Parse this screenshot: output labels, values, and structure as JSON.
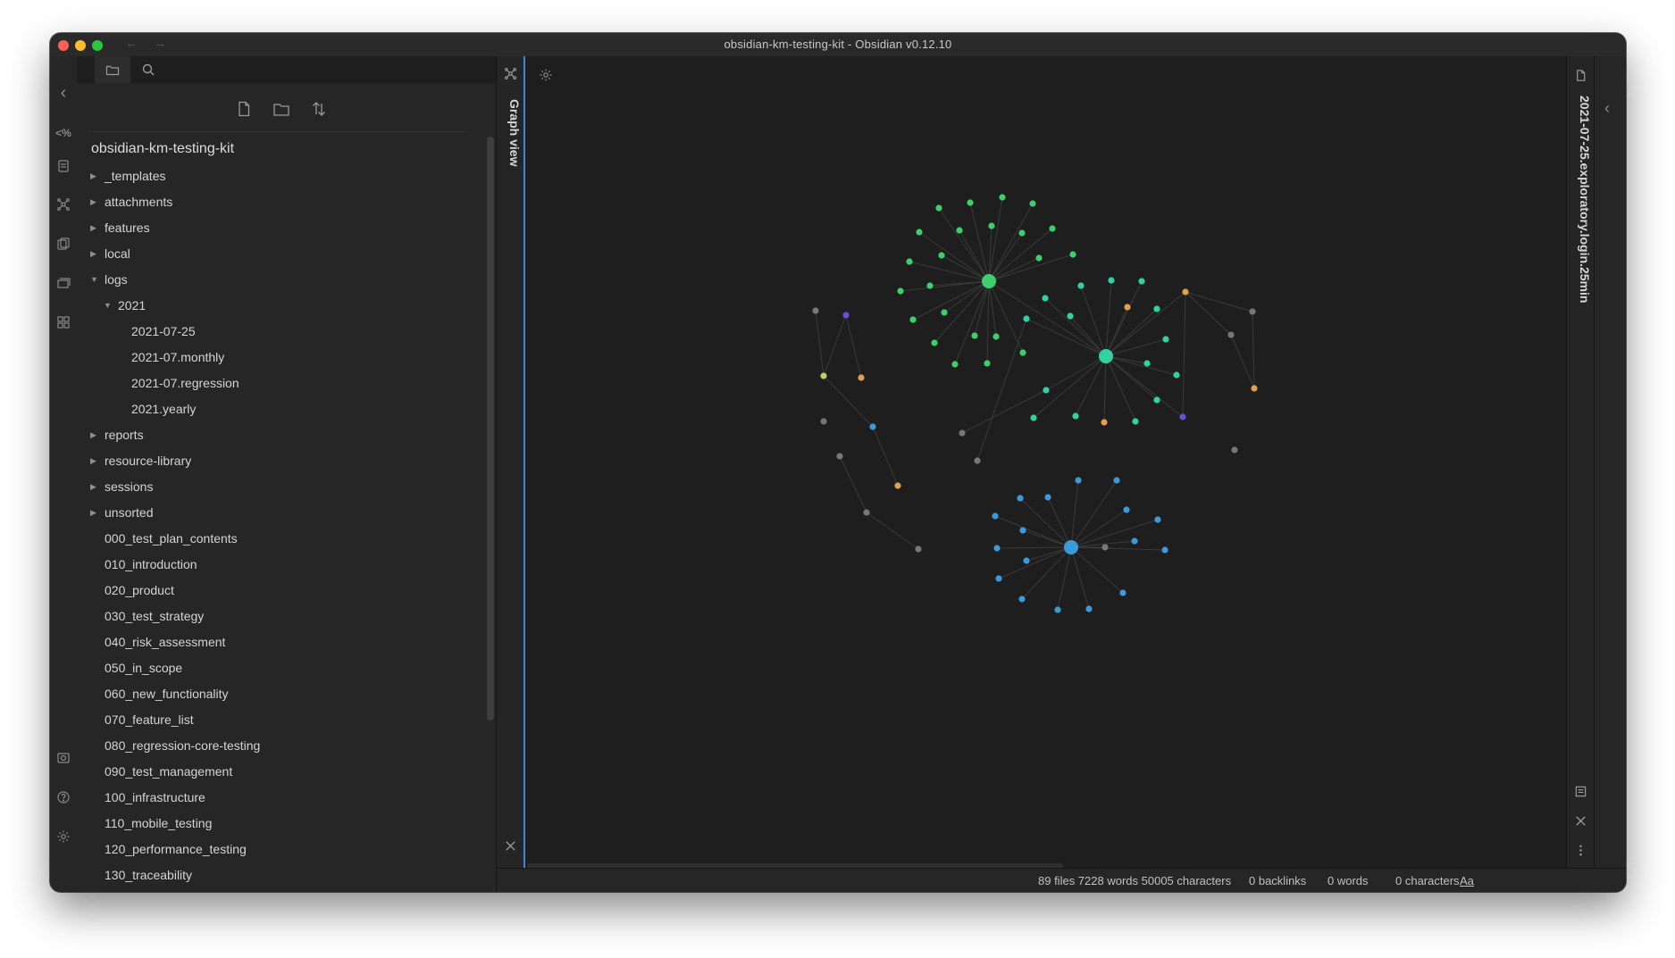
{
  "window": {
    "title": "obsidian-km-testing-kit - Obsidian v0.12.10"
  },
  "titlebar": {
    "back_arrow": "←",
    "forward_arrow": "→"
  },
  "ribbon": {
    "items": [
      {
        "name": "collapse-left-icon",
        "glyph": "‹"
      },
      {
        "name": "templater-icon",
        "glyph": "<%"
      },
      {
        "name": "daily-notes-icon",
        "glyph": "▤"
      },
      {
        "name": "graph-icon",
        "glyph": "⁂"
      },
      {
        "name": "slides-icon",
        "glyph": "❐"
      },
      {
        "name": "kanban-icon",
        "glyph": "▦"
      },
      {
        "name": "plugins-icon",
        "glyph": "▥"
      },
      {
        "name": "vault-icon",
        "glyph": "▣"
      },
      {
        "name": "help-icon",
        "glyph": "?"
      },
      {
        "name": "settings-icon",
        "glyph": "⚙"
      }
    ]
  },
  "sidebar": {
    "tabs": [
      {
        "name": "file-explorer-tab"
      },
      {
        "name": "search-tab"
      }
    ],
    "actions": [
      "new-note",
      "new-folder",
      "change-sort-order"
    ],
    "vault_name": "obsidian-km-testing-kit",
    "tree": [
      {
        "label": "_templates",
        "type": "folder",
        "level": 1,
        "expanded": false
      },
      {
        "label": "attachments",
        "type": "folder",
        "level": 1,
        "expanded": false
      },
      {
        "label": "features",
        "type": "folder",
        "level": 1,
        "expanded": false
      },
      {
        "label": "local",
        "type": "folder",
        "level": 1,
        "expanded": false
      },
      {
        "label": "logs",
        "type": "folder",
        "level": 1,
        "expanded": true
      },
      {
        "label": "2021",
        "type": "folder",
        "level": 2,
        "expanded": true
      },
      {
        "label": "2021-07-25",
        "type": "file",
        "level": 3
      },
      {
        "label": "2021-07.monthly",
        "type": "file",
        "level": 3
      },
      {
        "label": "2021-07.regression",
        "type": "file",
        "level": 3
      },
      {
        "label": "2021.yearly",
        "type": "file",
        "level": 3
      },
      {
        "label": "reports",
        "type": "folder",
        "level": 1,
        "expanded": false
      },
      {
        "label": "resource-library",
        "type": "folder",
        "level": 1,
        "expanded": false
      },
      {
        "label": "sessions",
        "type": "folder",
        "level": 1,
        "expanded": false
      },
      {
        "label": "unsorted",
        "type": "folder",
        "level": 1,
        "expanded": false
      },
      {
        "label": "000_test_plan_contents",
        "type": "file",
        "level": 1
      },
      {
        "label": "010_introduction",
        "type": "file",
        "level": 1
      },
      {
        "label": "020_product",
        "type": "file",
        "level": 1
      },
      {
        "label": "030_test_strategy",
        "type": "file",
        "level": 1
      },
      {
        "label": "040_risk_assessment",
        "type": "file",
        "level": 1
      },
      {
        "label": "050_in_scope",
        "type": "file",
        "level": 1
      },
      {
        "label": "060_new_functionality",
        "type": "file",
        "level": 1
      },
      {
        "label": "070_feature_list",
        "type": "file",
        "level": 1
      },
      {
        "label": "080_regression-core-testing",
        "type": "file",
        "level": 1
      },
      {
        "label": "090_test_management",
        "type": "file",
        "level": 1
      },
      {
        "label": "100_infrastructure",
        "type": "file",
        "level": 1
      },
      {
        "label": "110_mobile_testing",
        "type": "file",
        "level": 1
      },
      {
        "label": "120_performance_testing",
        "type": "file",
        "level": 1
      },
      {
        "label": "130_traceability",
        "type": "file",
        "level": 1
      }
    ]
  },
  "graph_view": {
    "tab_label": "Graph view",
    "colors": {
      "green": "#3ccf6c",
      "teal": "#2fd3a0",
      "blue": "#3b9ad9",
      "orange": "#e0a050",
      "purple": "#6a4fd9",
      "gray": "#777777",
      "yellowgreen": "#b8d45a",
      "edge": "#3a3a3a"
    }
  },
  "right_panel": {
    "note_title": "2021-07-25.exploratory.login.25min"
  },
  "statusbar": {
    "stats": "89 files 7228 words 50005 characters",
    "backlinks": "0 backlinks",
    "words": "0 words",
    "characters": "0 characters",
    "font_toggle": "Aa"
  }
}
